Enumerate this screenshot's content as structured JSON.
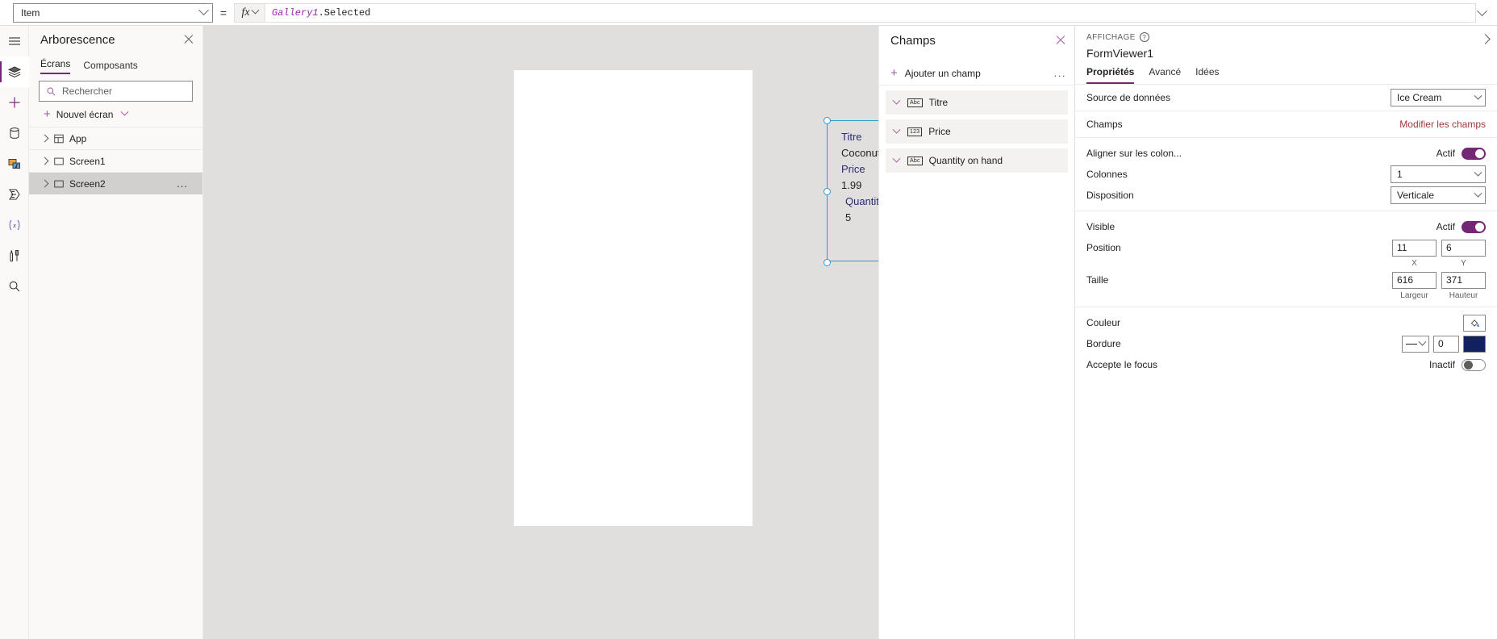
{
  "formula_bar": {
    "property_selected": "Item",
    "equals": "=",
    "fx_label": "fx",
    "formula_object": "Gallery1",
    "formula_rest": ".Selected"
  },
  "rail": {
    "items": [
      {
        "name": "menu-icon",
        "title": "Menu"
      },
      {
        "name": "tree-view-icon",
        "title": "Arborescence"
      },
      {
        "name": "insert-plus-icon",
        "title": "Insérer"
      },
      {
        "name": "data-icon",
        "title": "Données"
      },
      {
        "name": "media-icon",
        "title": "Média"
      },
      {
        "name": "power-automate-icon",
        "title": "Power Automate"
      },
      {
        "name": "variables-icon",
        "title": "Variables"
      },
      {
        "name": "tools-icon",
        "title": "Outils"
      },
      {
        "name": "search-icon",
        "title": "Rechercher"
      }
    ]
  },
  "tree": {
    "title": "Arborescence",
    "tabs": [
      {
        "label": "Écrans",
        "selected": true
      },
      {
        "label": "Composants",
        "selected": false
      }
    ],
    "search_placeholder": "Rechercher",
    "new_screen_label": "Nouvel écran",
    "rows": [
      {
        "label": "App",
        "icon": "app-icon",
        "selected": false
      },
      {
        "label": "Screen1",
        "icon": "screen-icon",
        "selected": false
      },
      {
        "label": "Screen2",
        "icon": "screen-icon",
        "selected": true
      }
    ]
  },
  "canvas": {
    "form_rows": [
      {
        "label": "Titre",
        "value": "Coconut",
        "indent": false
      },
      {
        "label": "Price",
        "value": "1.99",
        "indent": false
      },
      {
        "label": "Quantity on hand",
        "value": "5",
        "indent": true
      }
    ]
  },
  "fields_panel": {
    "title": "Champs",
    "add_field_label": "Ajouter un champ",
    "overflow_label": "...",
    "items": [
      {
        "label": "Titre",
        "type_badge": "Abc"
      },
      {
        "label": "Price",
        "type_badge": "123"
      },
      {
        "label": "Quantity on hand",
        "type_badge": "Abc"
      }
    ]
  },
  "properties": {
    "section_label": "AFFICHAGE",
    "help_glyph": "?",
    "control_name": "FormViewer1",
    "tabs": [
      {
        "label": "Propriétés",
        "selected": true
      },
      {
        "label": "Avancé",
        "selected": false
      },
      {
        "label": "Idées",
        "selected": false
      }
    ],
    "datasource": {
      "label": "Source de données",
      "value": "Ice Cream"
    },
    "fields": {
      "label": "Champs",
      "action": "Modifier les champs"
    },
    "snap_columns": {
      "label": "Aligner sur les colon...",
      "state": "Actif",
      "on": true
    },
    "columns": {
      "label": "Colonnes",
      "value": "1"
    },
    "layout": {
      "label": "Disposition",
      "value": "Verticale"
    },
    "visible": {
      "label": "Visible",
      "state": "Actif",
      "on": true
    },
    "position": {
      "label": "Position",
      "x": "11",
      "y": "6",
      "x_sub": "X",
      "y_sub": "Y"
    },
    "size": {
      "label": "Taille",
      "width": "616",
      "height": "371",
      "width_sub": "Largeur",
      "height_sub": "Hauteur"
    },
    "color": {
      "label": "Couleur"
    },
    "border": {
      "label": "Bordure",
      "width": "0",
      "color_hex": "#102060"
    },
    "focus": {
      "label": "Accepte le focus",
      "state": "Inactif",
      "on": false
    }
  },
  "colors": {
    "accent": "#742774",
    "link": "#a4373a",
    "selection": "#2e97d8",
    "canvas_bg": "#e1dfdd"
  }
}
